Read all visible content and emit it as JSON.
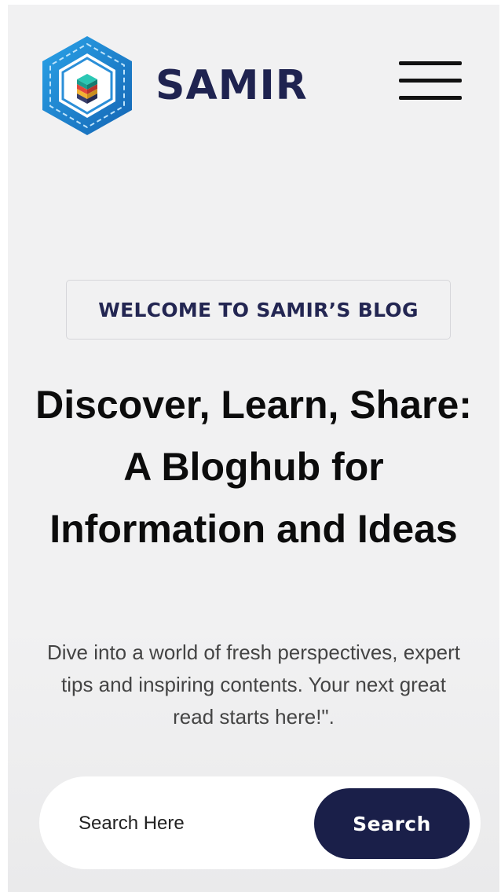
{
  "header": {
    "brand": "SAMIR",
    "logo_icon": "hexagon-layered-stack-logo",
    "menu_icon": "hamburger-menu-icon"
  },
  "hero": {
    "badge": "WELCOME TO SAMIR’S BLOG",
    "title": "Discover, Learn, Share: A Bloghub for Information and Ideas",
    "subtitle": "Dive into a world of fresh perspectives, expert tips and inspiring contents. Your next great read starts here!\"."
  },
  "search": {
    "placeholder": "Search Here",
    "value": "",
    "button_label": "Search"
  },
  "colors": {
    "brand_navy": "#1f2350",
    "button_navy": "#1a1f49",
    "background": "#f1f1f2",
    "logo_blue": "#1e7fd0"
  }
}
